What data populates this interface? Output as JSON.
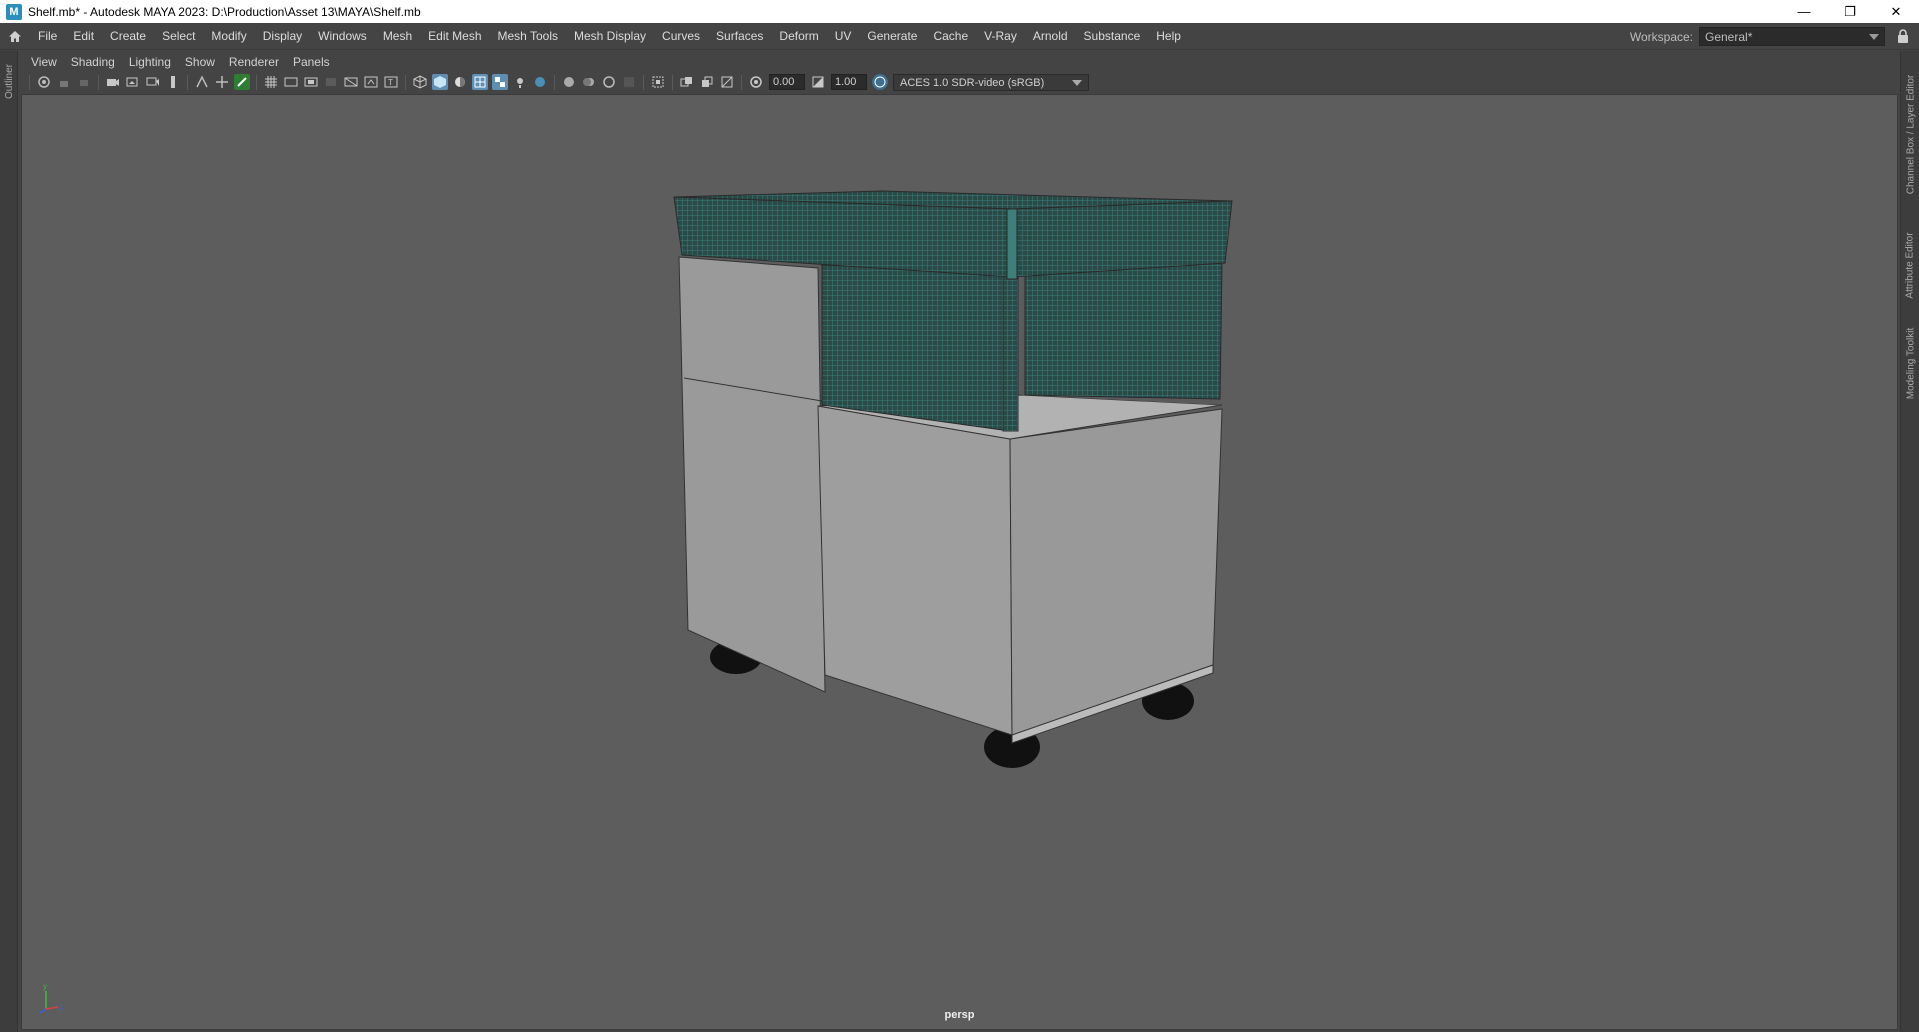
{
  "window": {
    "title": "Shelf.mb* - Autodesk MAYA 2023: D:\\Production\\Asset 13\\MAYA\\Shelf.mb",
    "controls": {
      "minimize": "—",
      "restore": "❐",
      "close": "✕"
    }
  },
  "menubar": {
    "items": [
      "File",
      "Edit",
      "Create",
      "Select",
      "Modify",
      "Display",
      "Windows",
      "Mesh",
      "Edit Mesh",
      "Mesh Tools",
      "Mesh Display",
      "Curves",
      "Surfaces",
      "Deform",
      "UV",
      "Generate",
      "Cache",
      "V-Ray",
      "Arnold",
      "Substance",
      "Help"
    ],
    "workspace_label": "Workspace:",
    "workspace_value": "General*"
  },
  "left_panel": {
    "tab": "Outliner"
  },
  "right_panel": {
    "tabs": [
      "Channel Box / Layer Editor",
      "Attribute Editor",
      "Modeling Toolkit"
    ]
  },
  "panel_menu": {
    "items": [
      "View",
      "Shading",
      "Lighting",
      "Show",
      "Renderer",
      "Panels"
    ]
  },
  "panel_toolbar": {
    "exposure": "0.00",
    "gamma": "1.00",
    "color_space": "ACES 1.0 SDR-video (sRGB)"
  },
  "viewport": {
    "camera": "persp",
    "background_color": "#5d5d5d",
    "wireframe_color": "#3d7f7a"
  }
}
